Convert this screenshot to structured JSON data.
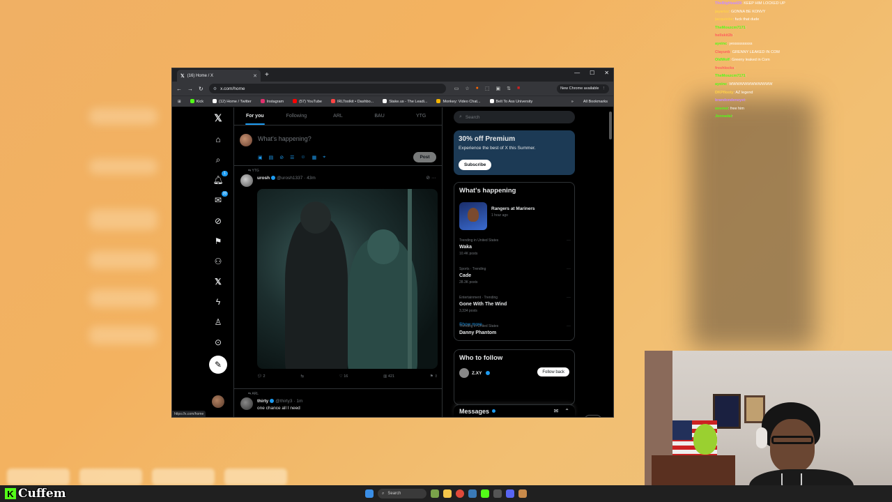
{
  "chat": {
    "lines": [
      {
        "user": "TheBigHead29",
        "msg": "KEEP HIM LOCKED UP",
        "color": "#c98aff"
      },
      {
        "user": "jayarizz",
        "msg": "GONNA BE KONVY",
        "color": "#ffd24a"
      },
      {
        "user": "jacquinbe",
        "msg": "fuck that dude",
        "color": "#ffd24a"
      },
      {
        "user": "TheMoszcm7171",
        "msg": "",
        "color": "#53fc18"
      },
      {
        "user": "hellskit2b",
        "msg": "",
        "color": "#ff5d5d"
      },
      {
        "user": "ayeinc",
        "msg": "yessssssssss",
        "color": "#53fc18"
      },
      {
        "user": "Clayunb",
        "msg": "GRENNY LEAKED IN COM",
        "color": "#ff5d5d"
      },
      {
        "user": "OldWolf",
        "msg": "Greeny leaked in Com",
        "color": "#53fc18"
      },
      {
        "user": "freshlocks",
        "msg": "",
        "color": "#ff5d5d"
      },
      {
        "user": "TheMoszcm7171",
        "msg": "",
        "color": "#53fc18"
      },
      {
        "user": "ayeinc",
        "msg": "WWWWWWWWWWWW",
        "color": "#53fc18"
      },
      {
        "user": "DKPflooty",
        "msg": "AZ legend",
        "color": "#ffd24a"
      },
      {
        "user": "brandondenoyet",
        "msg": "",
        "color": "#c98aff"
      },
      {
        "user": "sosmsl",
        "msg": "free him",
        "color": "#53fc18"
      },
      {
        "user": "Jonnadai",
        "msg": "",
        "color": "#53fc18"
      }
    ]
  },
  "browser": {
    "tab_title": "(16) Home / X",
    "url": "x.com/home",
    "update_label": "New Chrome available",
    "bookmarks": [
      {
        "label": "Kick",
        "color": "#53fc18"
      },
      {
        "label": "(12) Home / Twitter",
        "color": "#ffffff"
      },
      {
        "label": "Instagram",
        "color": "#e1306c"
      },
      {
        "label": "(57) YouTube",
        "color": "#ff0000"
      },
      {
        "label": "IRLToolkit • Dashbo...",
        "color": "#ff4444"
      },
      {
        "label": "Stake.us - The Leadi...",
        "color": "#ffffff"
      },
      {
        "label": "Monkey: Video Chat...",
        "color": "#f4b400"
      },
      {
        "label": "Belt To Ass University",
        "color": "#ffffff"
      }
    ],
    "all_bookmarks": "All Bookmarks",
    "status_url": "https://x.com/home"
  },
  "x": {
    "tabs": [
      "For you",
      "Following",
      "ARL",
      "BAU",
      "YTG"
    ],
    "composer_placeholder": "What's happening?",
    "post_label": "Post",
    "notif_badge": "1",
    "msg_badge": "20",
    "tweet": {
      "context": "YTG",
      "name": "urosh",
      "handle_time": "@urosh1337 · 43m",
      "reply_count": "2",
      "like_count": "16",
      "view_count": "421"
    },
    "tweet2": {
      "context": "ARL",
      "name": "thirty",
      "handle_time": "@thirty3 · 1m",
      "text": "one chance all I need"
    },
    "search_placeholder": "Search",
    "premium": {
      "title": "30% off Premium",
      "text": "Experience the best of X this Summer.",
      "button": "Subscribe"
    },
    "whats_happening": {
      "title": "What's happening",
      "event_title": "Rangers at Mariners",
      "event_time": "1 hour ago",
      "trends": [
        {
          "context": "Trending in United States",
          "name": "Waka",
          "posts": "10.4K posts"
        },
        {
          "context": "Sports · Trending",
          "name": "Cade",
          "posts": "28.3K posts"
        },
        {
          "context": "Entertainment · Trending",
          "name": "Gone With The Wind",
          "posts": "3,334 posts"
        },
        {
          "context": "Trending in United States",
          "name": "Danny Phantom",
          "posts": ""
        }
      ],
      "show_more": "Show more"
    },
    "who_to_follow": {
      "title": "Who to follow",
      "user": "Z.XY",
      "button": "Follow back"
    },
    "messages_title": "Messages"
  },
  "taskbar": {
    "search_label": "Search"
  },
  "streamer": {
    "name": "Cuffem"
  }
}
